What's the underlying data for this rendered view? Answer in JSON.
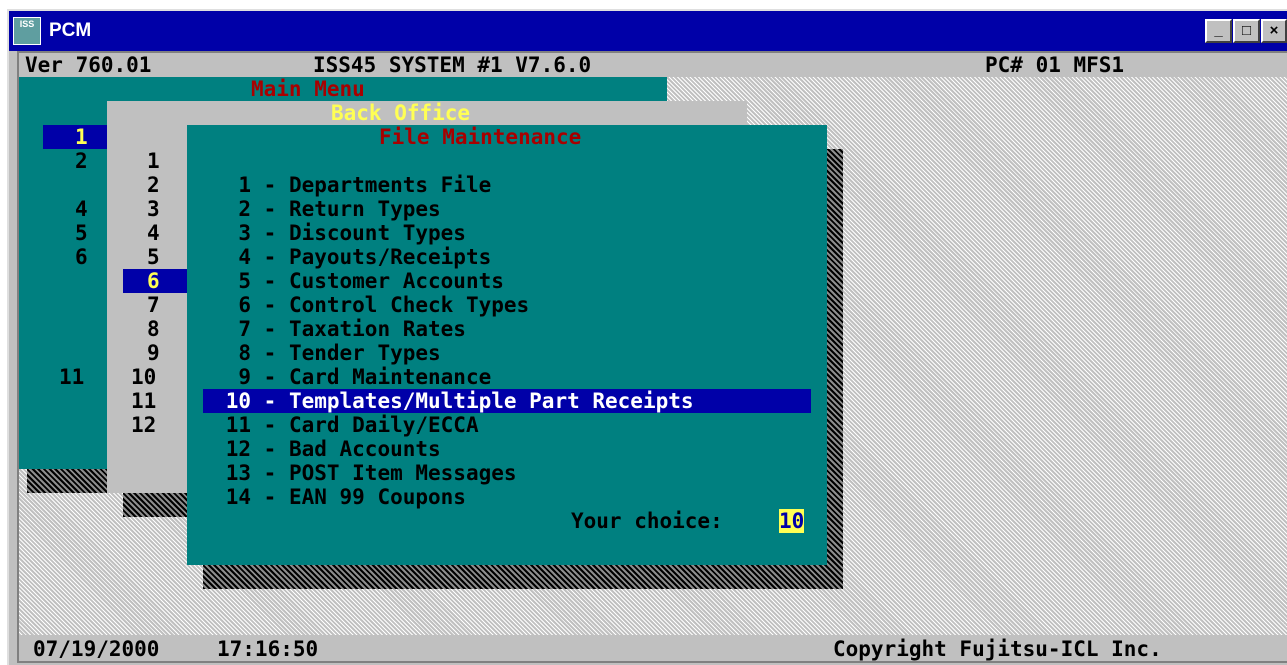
{
  "window": {
    "title": "PCM",
    "icon_label": "ISS",
    "icon_name": "pcm-app-icon",
    "controls": {
      "minimize": "_",
      "maximize": "□",
      "close": "×"
    }
  },
  "status_top": {
    "version": "Ver 760.01",
    "system": "ISS45 SYSTEM #1 V7.6.0",
    "pc": "PC# 01 MFS1"
  },
  "status_bottom": {
    "date": "07/19/2000",
    "time": "17:16:50",
    "copyright": "Copyright Fujitsu-ICL Inc."
  },
  "main_menu": {
    "title": "Main Menu",
    "numbers": [
      "1",
      "2",
      "4",
      "5",
      "6",
      "11"
    ],
    "selected": "1"
  },
  "back_office": {
    "title": "Back Office",
    "numbers": [
      "1",
      "2",
      "3",
      "4",
      "5",
      "6",
      "7",
      "8",
      "9",
      "10",
      "11",
      "12"
    ],
    "selected": "6"
  },
  "file_maintenance": {
    "title": "File Maintenance",
    "items": [
      {
        "num": "1",
        "label": "Departments File"
      },
      {
        "num": "2",
        "label": "Return Types"
      },
      {
        "num": "3",
        "label": "Discount Types"
      },
      {
        "num": "4",
        "label": "Payouts/Receipts"
      },
      {
        "num": "5",
        "label": "Customer Accounts"
      },
      {
        "num": "6",
        "label": "Control Check Types"
      },
      {
        "num": "7",
        "label": "Taxation Rates"
      },
      {
        "num": "8",
        "label": "Tender Types"
      },
      {
        "num": "9",
        "label": "Card Maintenance"
      },
      {
        "num": "10",
        "label": "Templates/Multiple Part Receipts"
      },
      {
        "num": "11",
        "label": "Card Daily/ECCA"
      },
      {
        "num": "12",
        "label": "Bad Accounts"
      },
      {
        "num": "13",
        "label": "POST Item Messages"
      },
      {
        "num": "14",
        "label": "EAN 99 Coupons"
      }
    ],
    "selected_index": 9,
    "choice_label": "Your choice:",
    "choice_value": "10"
  },
  "colors": {
    "teal": "#008080",
    "dark_red": "#a80000",
    "yellow": "#ffff54",
    "navy": "#0000a8",
    "gray": "#c0c0c0"
  }
}
